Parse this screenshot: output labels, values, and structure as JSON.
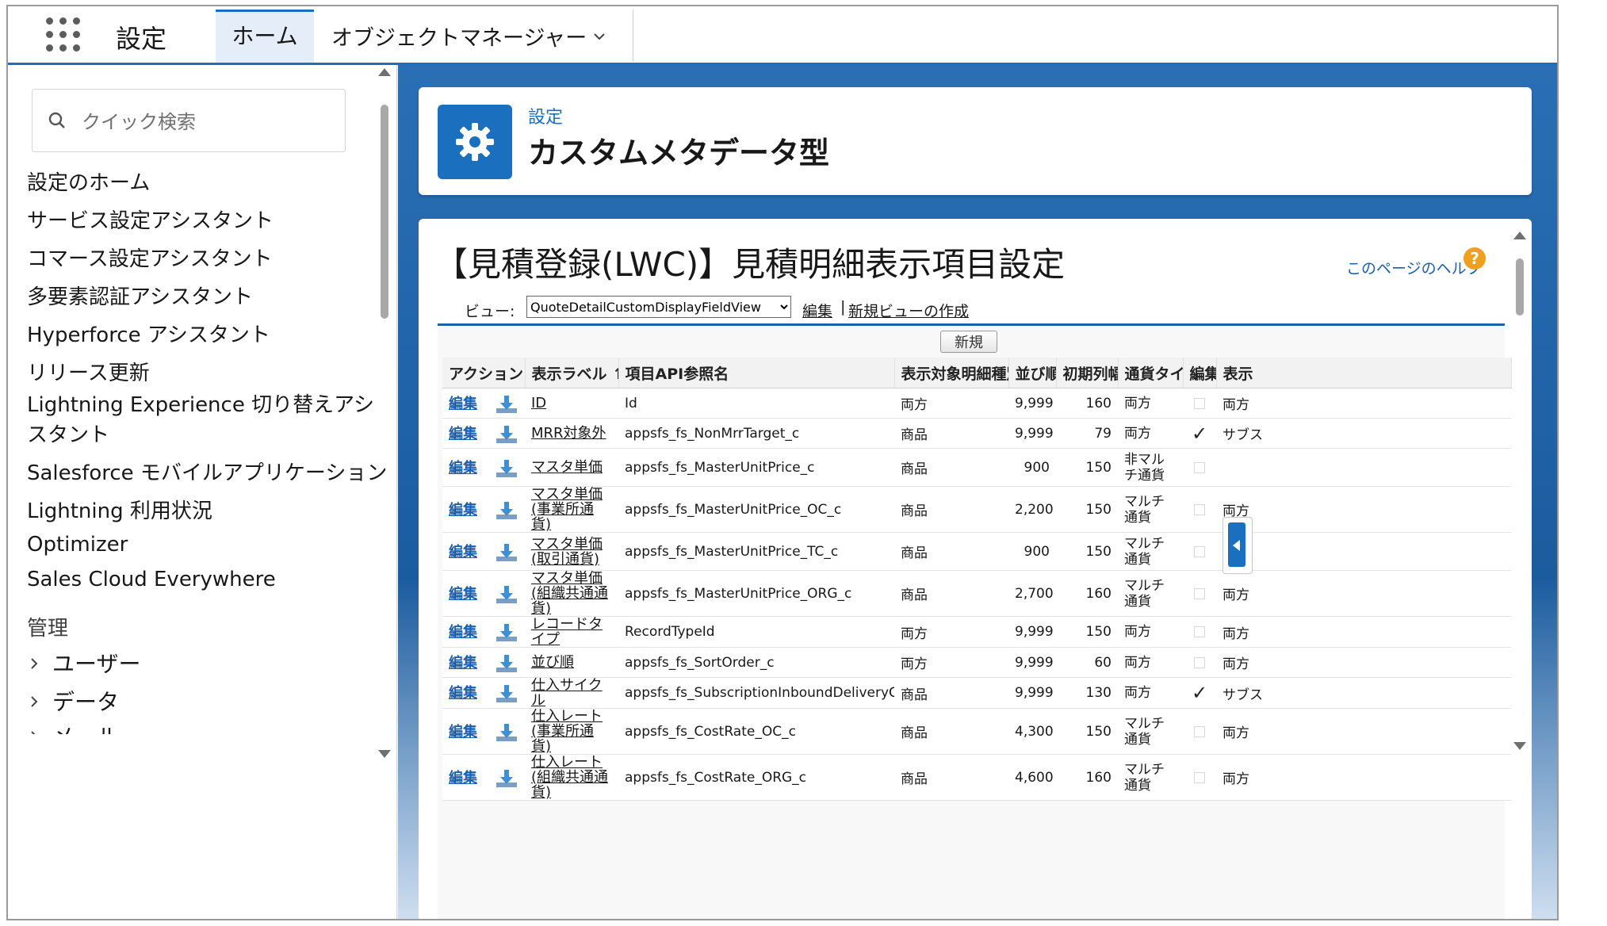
{
  "topbar": {
    "app_title": "設定",
    "tabs": [
      {
        "label": "ホーム",
        "active": true
      },
      {
        "label": "オブジェクトマネージャー",
        "active": false
      }
    ]
  },
  "sidebar": {
    "search_placeholder": "クイック検索",
    "items": [
      "設定のホーム",
      "サービス設定アシスタント",
      "コマース設定アシスタント",
      "多要素認証アシスタント",
      "Hyperforce アシスタント",
      "リリース更新",
      "Lightning Experience 切り替えアシスタント",
      "Salesforce モバイルアプリケーション",
      "Lightning 利用状況",
      "Optimizer",
      "Sales Cloud Everywhere"
    ],
    "section_heading": "管理",
    "tree": [
      "ユーザー",
      "データ",
      "メール"
    ]
  },
  "header": {
    "kicker": "設定",
    "title": "カスタムメタデータ型"
  },
  "content": {
    "heading": "【見積登録(LWC)】見積明細表示項目設定",
    "help_link": "このページのヘルプ",
    "view_label": "ビュー:",
    "view_selected": "QuoteDetailCustomDisplayFieldView",
    "view_edit": "編集",
    "view_separator": "|",
    "view_new": "新規ビューの作成",
    "new_button": "新規"
  },
  "table": {
    "columns": [
      "アクション",
      "表示ラベル ↑",
      "項目API参照名",
      "表示対象明細種別",
      "並び順",
      "初期列幅",
      "通貨タイプ",
      "編集",
      "表示"
    ],
    "edit_label": "編集",
    "rows": [
      {
        "label": "ID",
        "api": "Id",
        "type": "両方",
        "order": "9,999",
        "width": "160",
        "currency": "両方",
        "editable": false,
        "display": "両方"
      },
      {
        "label": "MRR対象外",
        "api": "appsfs_fs_NonMrrTarget_c",
        "type": "商品",
        "order": "9,999",
        "width": "79",
        "currency": "両方",
        "editable": true,
        "display": "サブス"
      },
      {
        "label": "マスタ単価",
        "api": "appsfs_fs_MasterUnitPrice_c",
        "type": "商品",
        "order": "900",
        "width": "150",
        "currency": "非マルチ通貨",
        "editable": false,
        "display": ""
      },
      {
        "label": "マスタ単価(事業所通貨)",
        "api": "appsfs_fs_MasterUnitPrice_OC_c",
        "type": "商品",
        "order": "2,200",
        "width": "150",
        "currency": "マルチ通貨",
        "editable": false,
        "display": "両方"
      },
      {
        "label": "マスタ単価(取引通貨)",
        "api": "appsfs_fs_MasterUnitPrice_TC_c",
        "type": "商品",
        "order": "900",
        "width": "150",
        "currency": "マルチ通貨",
        "editable": false,
        "display": "両方"
      },
      {
        "label": "マスタ単価(組織共通通貨)",
        "api": "appsfs_fs_MasterUnitPrice_ORG_c",
        "type": "商品",
        "order": "2,700",
        "width": "160",
        "currency": "マルチ通貨",
        "editable": false,
        "display": "両方"
      },
      {
        "label": "レコードタイプ",
        "api": "RecordTypeId",
        "type": "両方",
        "order": "9,999",
        "width": "150",
        "currency": "両方",
        "editable": false,
        "display": "両方"
      },
      {
        "label": "並び順",
        "api": "appsfs_fs_SortOrder_c",
        "type": "両方",
        "order": "9,999",
        "width": "60",
        "currency": "両方",
        "editable": false,
        "display": "両方"
      },
      {
        "label": "仕入サイクル",
        "api": "appsfs_fs_SubscriptionInboundDeliveryCycle_c",
        "type": "商品",
        "order": "9,999",
        "width": "130",
        "currency": "両方",
        "editable": true,
        "display": "サブス"
      },
      {
        "label": "仕入レート(事業所通貨)",
        "api": "appsfs_fs_CostRate_OC_c",
        "type": "商品",
        "order": "4,300",
        "width": "150",
        "currency": "マルチ通貨",
        "editable": false,
        "display": "両方"
      },
      {
        "label": "仕入レート(組織共通通貨)",
        "api": "appsfs_fs_CostRate_ORG_c",
        "type": "商品",
        "order": "4,600",
        "width": "160",
        "currency": "マルチ通貨",
        "editable": false,
        "display": "両方"
      }
    ]
  },
  "colors": {
    "brand": "#1b6fbf",
    "link": "#1b5fb0",
    "help_icon": "#f0a020"
  }
}
